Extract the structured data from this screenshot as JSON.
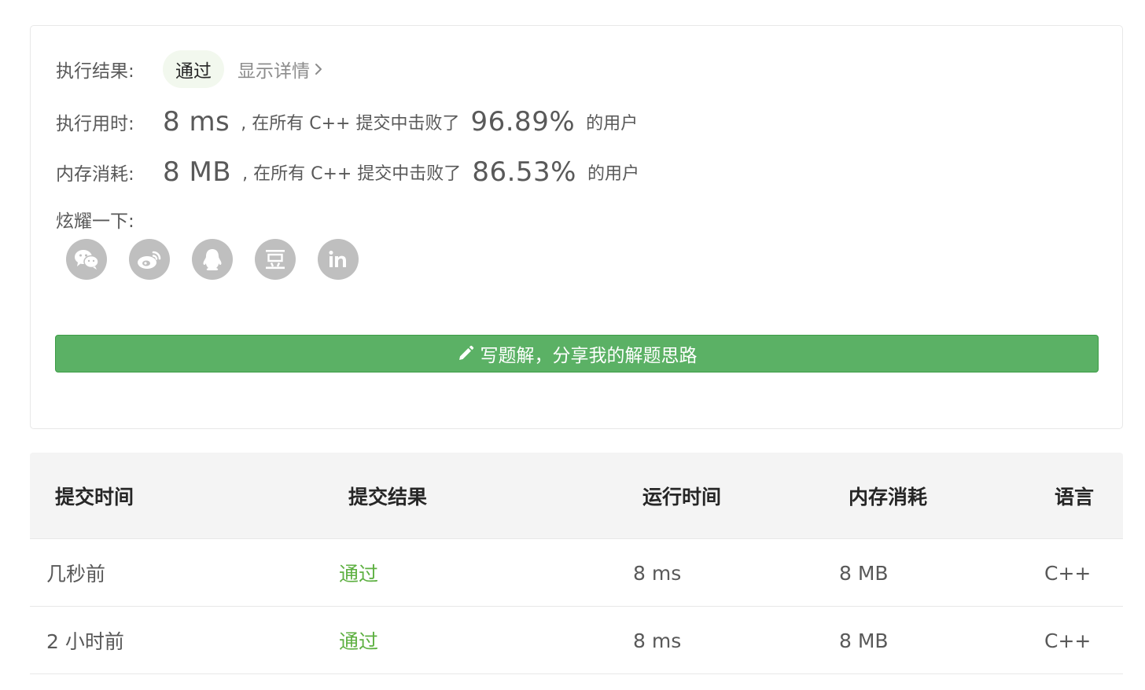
{
  "result": {
    "label": "执行结果:",
    "status": "通过",
    "details_link": "显示详情"
  },
  "runtime": {
    "label": "执行用时:",
    "value": "8 ms",
    "middle_text": ", 在所有 C++ 提交中击败了",
    "percent": "96.89%",
    "suffix": "的用户"
  },
  "memory": {
    "label": "内存消耗:",
    "value": "8 MB",
    "middle_text": ", 在所有 C++ 提交中击败了",
    "percent": "86.53%",
    "suffix": "的用户"
  },
  "share": {
    "label": "炫耀一下:",
    "icons": [
      "wechat-icon",
      "weibo-icon",
      "qq-icon",
      "douban-icon",
      "linkedin-icon"
    ]
  },
  "solution_button": {
    "label": "写题解，分享我的解题思路",
    "icon": "pencil-icon"
  },
  "table": {
    "headers": [
      "提交时间",
      "提交结果",
      "运行时间",
      "内存消耗",
      "语言"
    ],
    "rows": [
      {
        "time": "几秒前",
        "result": "通过",
        "runtime": "8 ms",
        "memory": "8 MB",
        "language": "C++"
      },
      {
        "time": "2 小时前",
        "result": "通过",
        "runtime": "8 ms",
        "memory": "8 MB",
        "language": "C++"
      }
    ]
  },
  "colors": {
    "pass_green": "#5eb042",
    "button_green": "#5bb165",
    "pill_bg": "#f2f8ee",
    "icon_gray": "#bfbfbf"
  }
}
